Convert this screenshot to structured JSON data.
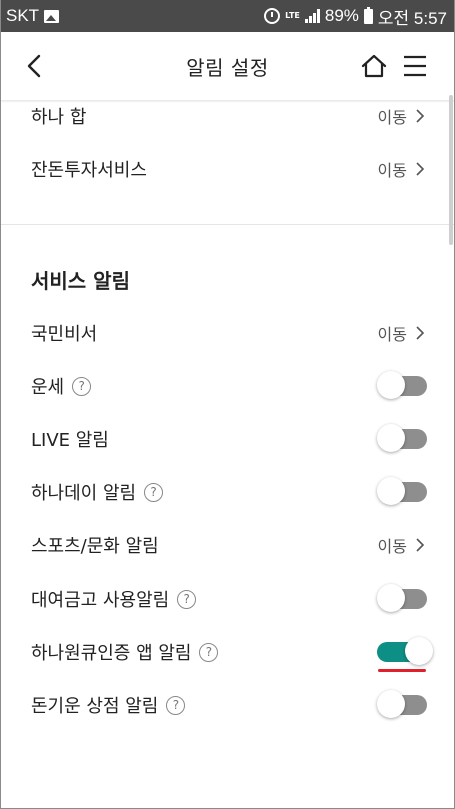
{
  "status_bar": {
    "carrier": "SKT",
    "lte": "LTE",
    "battery": "89%",
    "time": "오전 5:57",
    "icons": [
      "image-icon",
      "alarm-icon",
      "lte-icon",
      "signal-icon",
      "battery-icon"
    ]
  },
  "header": {
    "title": "알림 설정",
    "icons": [
      "back-arrow-icon",
      "home-icon",
      "menu-icon"
    ]
  },
  "top_rows": [
    {
      "label": "하나 합",
      "action": "이동"
    },
    {
      "label": "잔돈투자서비스",
      "action": "이동"
    }
  ],
  "section": {
    "title": "서비스 알림",
    "rows": [
      {
        "label": "국민비서",
        "action": "이동"
      },
      {
        "label": "운세",
        "help": "?",
        "toggle": "off"
      },
      {
        "label": "LIVE 알림",
        "toggle": "off"
      },
      {
        "label": "하나데이 알림",
        "help": "?",
        "toggle": "off"
      },
      {
        "label": "스포츠/문화 알림",
        "action": "이동"
      },
      {
        "label": "대여금고 사용알림",
        "help": "?",
        "toggle": "off"
      },
      {
        "label": "하나원큐인증 앱 알림",
        "help": "?",
        "toggle": "on"
      },
      {
        "label": "돈기운 상점 알림",
        "help": "?",
        "toggle": "off"
      }
    ]
  },
  "colors": {
    "status_bar": "#4a4a4a",
    "toggle_on": "#0e8f86",
    "toggle_off": "#8e8e8e",
    "highlight_underline": "#e0202a"
  }
}
